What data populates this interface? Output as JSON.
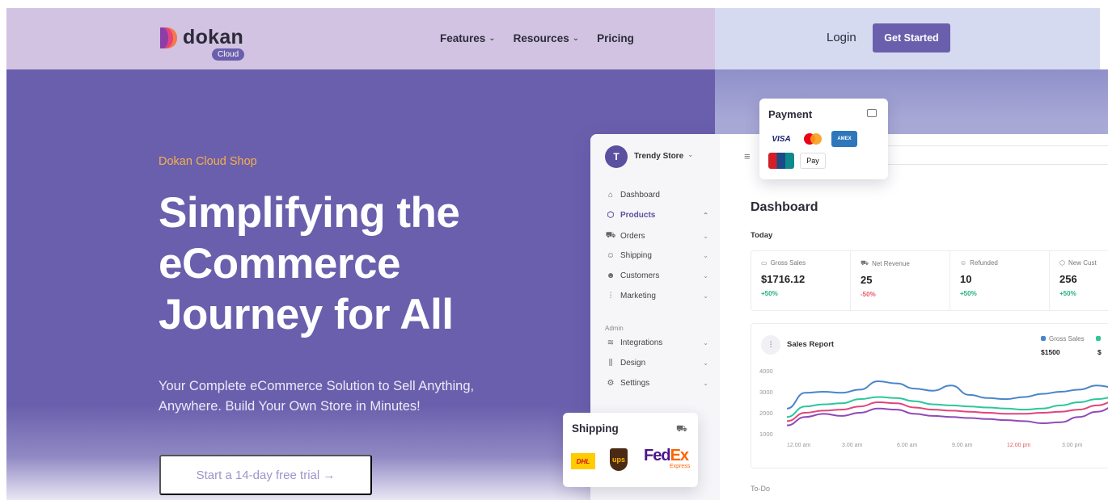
{
  "header": {
    "logo_text": "dokan",
    "logo_badge": "Cloud",
    "nav": [
      {
        "label": "Features",
        "has_dropdown": true
      },
      {
        "label": "Resources",
        "has_dropdown": true
      },
      {
        "label": "Pricing",
        "has_dropdown": false
      }
    ],
    "login_label": "Login",
    "cta_label": "Get Started"
  },
  "hero": {
    "eyebrow": "Dokan Cloud Shop",
    "headline_lines": [
      "Simplifying the",
      "eCommerce",
      "Journey for All"
    ],
    "subline_lines": [
      "Your Complete eCommerce Solution to Sell Anything,",
      "Anywhere. Build Your Own Store in Minutes!"
    ],
    "trial_button": "Start a 14-day free trial →"
  },
  "dashboard": {
    "store_initial": "T",
    "store_name": "Trendy Store",
    "sidebar": [
      {
        "label": "Dashboard",
        "icon": "home-icon",
        "chevron": ""
      },
      {
        "label": "Products",
        "icon": "cube-icon",
        "chevron": "⌃",
        "active": true
      },
      {
        "label": "Orders",
        "icon": "cart-icon",
        "chevron": "⌄"
      },
      {
        "label": "Shipping",
        "icon": "user-icon",
        "chevron": "⌄"
      },
      {
        "label": "Customers",
        "icon": "users-icon",
        "chevron": "⌄"
      },
      {
        "label": "Marketing",
        "icon": "bar-chart-icon",
        "chevron": "⌄"
      }
    ],
    "admin_label": "Admin",
    "admin_items": [
      {
        "label": "Integrations",
        "icon": "layers-icon",
        "chevron": "⌄"
      },
      {
        "label": "Design",
        "icon": "sliders-icon",
        "chevron": "⌄"
      },
      {
        "label": "Settings",
        "icon": "gear-icon",
        "chevron": "⌄"
      }
    ],
    "title": "Dashboard",
    "period": "Today",
    "stats": [
      {
        "label": "Gross Sales",
        "value": "$1716.12",
        "delta": "+50%",
        "trend": "up"
      },
      {
        "label": "Net Revenue",
        "value": "25",
        "delta": "-50%",
        "trend": "down"
      },
      {
        "label": "Refunded",
        "value": "10",
        "delta": "+50%",
        "trend": "up"
      },
      {
        "label": "New Cust",
        "value": "256",
        "delta": "+50%",
        "trend": "up"
      }
    ],
    "report": {
      "title": "Sales Report",
      "legend_label": "Gross Sales",
      "legend_value": "$1500",
      "legend_value_2": "$"
    },
    "todo_label": "To-Do"
  },
  "chart_data": {
    "type": "line",
    "ylim": [
      1000,
      4000
    ],
    "y_ticks": [
      "4000",
      "3000",
      "2000",
      "1000"
    ],
    "x_ticks": [
      "12.00 am",
      "3.00 am",
      "6.00 am",
      "9.00 am",
      "12.00 pm",
      "3.00 pm"
    ],
    "x_tick_colors": [
      "#999999",
      "#999999",
      "#999999",
      "#999999",
      "#e45a6a",
      "#999999"
    ],
    "x": [
      0,
      1,
      2,
      3,
      4,
      5,
      6,
      7,
      8,
      9,
      10,
      11,
      12,
      13,
      14,
      15,
      16,
      17,
      18
    ],
    "series": [
      {
        "color": "#4a85c9",
        "values": [
          2200,
          2950,
          3000,
          2950,
          3100,
          3500,
          3400,
          3150,
          3050,
          3300,
          2850,
          2700,
          2650,
          2750,
          2900,
          3000,
          3100,
          3300,
          3200
        ]
      },
      {
        "color": "#2cc79a",
        "values": [
          1800,
          2300,
          2400,
          2450,
          2650,
          2750,
          2700,
          2550,
          2400,
          2350,
          2300,
          2250,
          2200,
          2150,
          2200,
          2350,
          2500,
          2650,
          2750
        ]
      },
      {
        "color": "#e0457b",
        "values": [
          1600,
          2000,
          2100,
          2150,
          2300,
          2500,
          2450,
          2250,
          2150,
          2100,
          2050,
          2000,
          1950,
          1950,
          2000,
          2050,
          2150,
          2350,
          2550
        ]
      },
      {
        "color": "#8e4ab8",
        "values": [
          1400,
          1800,
          1950,
          1850,
          2000,
          2200,
          2150,
          1950,
          1850,
          1800,
          1750,
          1700,
          1650,
          1600,
          1500,
          1550,
          1800,
          2050,
          2300
        ]
      }
    ]
  },
  "payment_card": {
    "title": "Payment",
    "methods": [
      "VISA",
      "mastercard",
      "AMEX",
      "UnionPay",
      " Pay"
    ]
  },
  "shipping_card": {
    "title": "Shipping",
    "carriers": [
      "DHL",
      "ups",
      "FedEx"
    ],
    "fedex_sub": "Express"
  }
}
